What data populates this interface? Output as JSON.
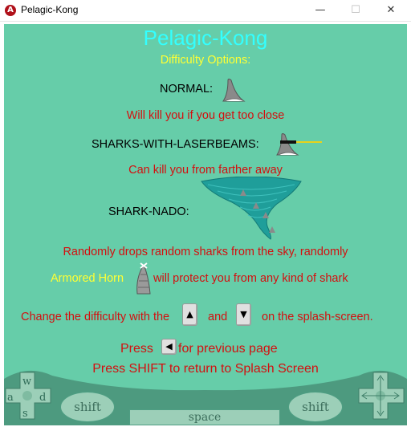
{
  "window": {
    "title": "Pelagic-Kong",
    "icon": "app-logo-icon",
    "buttons": [
      "minimize",
      "maximize",
      "close"
    ]
  },
  "game": {
    "title": "Pelagic-Kong",
    "subtitle": "Difficulty Options:",
    "normal_label": "NORMAL:",
    "normal_desc": "Will kill you if you get too close",
    "laser_label": "SHARKS-WITH-LASERBEAMS:",
    "laser_desc": "Can kill you from farther away",
    "nado_label": "SHARK-NADO:",
    "nado_desc": "Randomly drops random sharks from the sky, randomly",
    "horn_label": "Armored Horn",
    "horn_desc": "will protect you from any kind of shark",
    "change_prefix": "Change the difficulty with the",
    "change_and": "and",
    "change_suffix": "on the splash-screen.",
    "press_prefix": "Press",
    "press_suffix": "for previous page",
    "shift_return": "Press SHIFT to return to Splash Screen"
  },
  "controls": {
    "keys": {
      "w": "w",
      "a": "a",
      "s": "s",
      "d": "d"
    },
    "shift_left": "shift",
    "space": "space",
    "shift_right": "shift"
  },
  "colors": {
    "background": "#66cda9",
    "title": "#33ffff",
    "accent_yellow": "#ffff33",
    "desc_red": "#d40f0f"
  }
}
